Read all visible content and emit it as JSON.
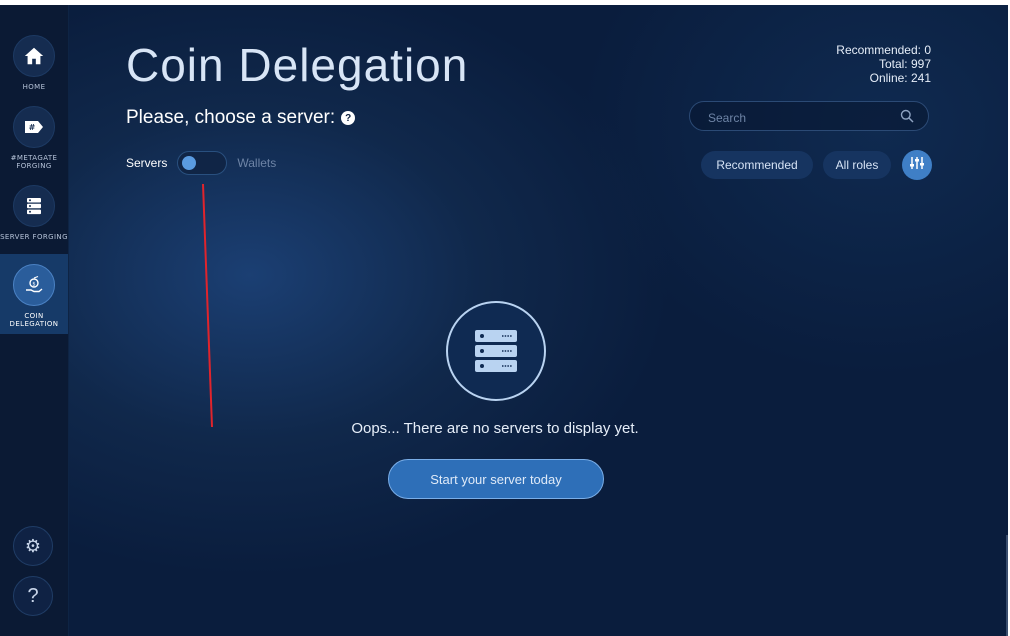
{
  "sidebar": {
    "items": [
      {
        "label": "HOME",
        "icon": "home-icon"
      },
      {
        "label": "#METAGATE FORGING",
        "icon": "hashtag-tag-icon"
      },
      {
        "label": "SERVER FORGING",
        "icon": "server-icon"
      },
      {
        "label": "COIN DELEGATION",
        "icon": "hand-coin-icon",
        "active": true
      }
    ],
    "settings_icon": "gear-icon",
    "help_label": "?"
  },
  "header": {
    "title": "Coin Delegation",
    "subtitle": "Please, choose a server:",
    "help_icon": "?"
  },
  "stats": {
    "recommended": "Recommended: 0",
    "total": "Total: 997",
    "online": "Online: 241"
  },
  "toggle": {
    "left_label": "Servers",
    "right_label": "Wallets"
  },
  "search": {
    "placeholder": "Search",
    "value": ""
  },
  "filters": {
    "recommended": "Recommended",
    "all_roles": "All roles",
    "settings_icon": "sliders-icon"
  },
  "empty_state": {
    "message": "Oops... There are no servers to display yet.",
    "button": "Start your server today",
    "icon": "server-stack-icon"
  },
  "colors": {
    "background": "#0a1d3d",
    "accent": "#2e6fb8",
    "annotation": "#e0242c"
  }
}
